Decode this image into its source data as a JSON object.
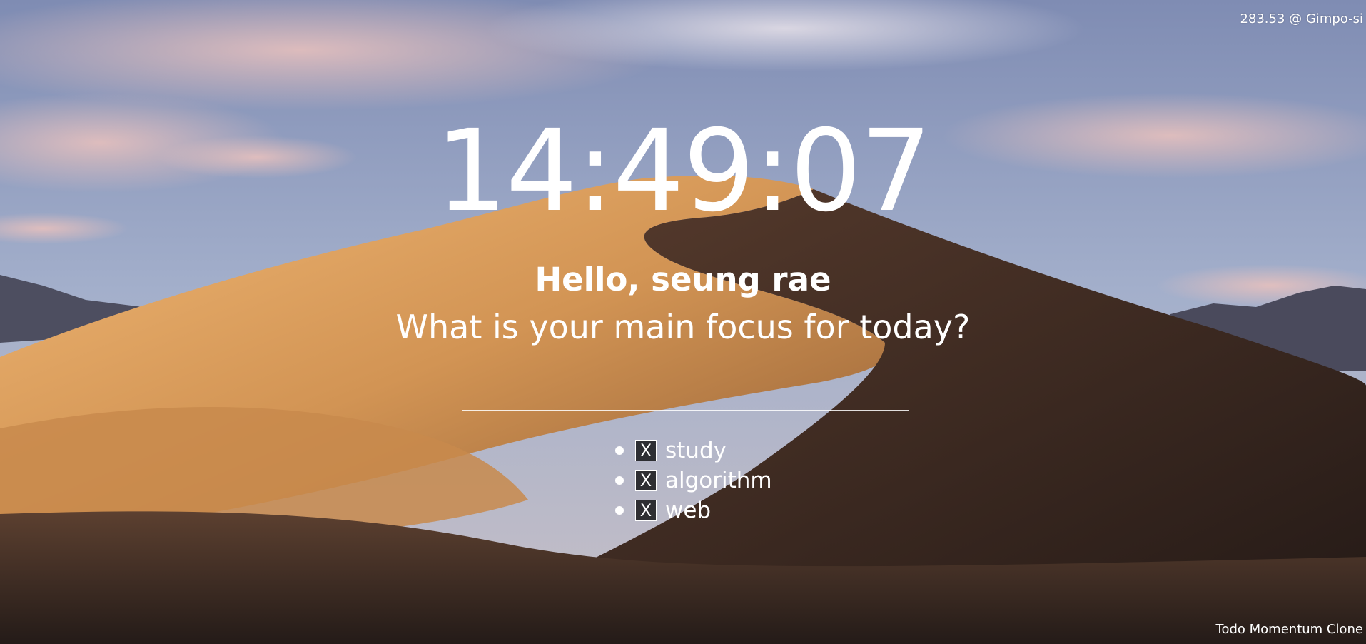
{
  "weather": {
    "text": "283.53 @ Gimpo-si"
  },
  "clock": {
    "time": "14:49:07"
  },
  "greeting": {
    "text": "Hello, seung rae"
  },
  "prompt": {
    "question": "What is your main focus for today?"
  },
  "todo_form": {
    "input_value": "",
    "input_placeholder": ""
  },
  "todos": [
    {
      "delete_label": "X",
      "text": "study"
    },
    {
      "delete_label": "X",
      "text": "algorithm"
    },
    {
      "delete_label": "X",
      "text": "web"
    }
  ],
  "footer": {
    "text": "Todo Momentum Clone"
  },
  "background": {
    "scene": "desert sand dunes at dusk",
    "sky_top": "#8b9bc2",
    "sky_bottom": "#b8b7c8",
    "cloud_pink": "#d9b3b5",
    "dune_light": "#e0a867",
    "dune_mid": "#b87b43",
    "dune_shadow": "#2f221d",
    "mountain": "#4b4c5e"
  }
}
